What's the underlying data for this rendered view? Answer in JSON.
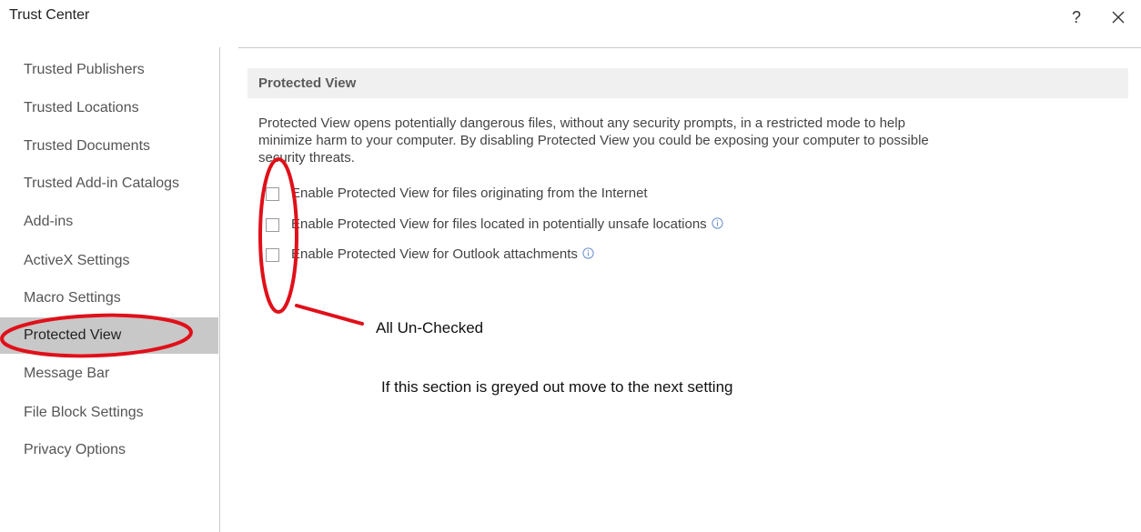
{
  "window": {
    "title": "Trust Center",
    "help_label": "?",
    "close_icon": "close-icon"
  },
  "sidebar": {
    "items": [
      {
        "label": "Trusted Publishers"
      },
      {
        "label": "Trusted Locations"
      },
      {
        "label": "Trusted Documents"
      },
      {
        "label": "Trusted Add-in Catalogs"
      },
      {
        "label": "Add-ins"
      },
      {
        "label": "ActiveX Settings"
      },
      {
        "label": "Macro Settings"
      },
      {
        "label": "Protected View"
      },
      {
        "label": "Message Bar"
      },
      {
        "label": "File Block Settings"
      },
      {
        "label": "Privacy Options"
      }
    ],
    "selected_label": "Protected View"
  },
  "main": {
    "section_title": "Protected View",
    "description_line_1": "Protected View opens potentially dangerous files, without any security prompts, in a restricted mode to help",
    "description_line_2": "minimize harm to your computer. By disabling Protected View you could be exposing your computer to possible",
    "description_line_3": "security threats.",
    "options": [
      {
        "label": "Enable Protected View for files originating from the Internet",
        "checked": false,
        "has_info_icon": false
      },
      {
        "label": "Enable Protected View for files located in potentially unsafe locations",
        "checked": false,
        "has_info_icon": true
      },
      {
        "label": "Enable Protected View for Outlook attachments",
        "checked": false,
        "has_info_icon": true
      }
    ]
  },
  "annotations": {
    "note_1": "All Un-Checked",
    "note_2": "If this section is greyed out move to the next setting",
    "mark_color": "#e0101a"
  }
}
